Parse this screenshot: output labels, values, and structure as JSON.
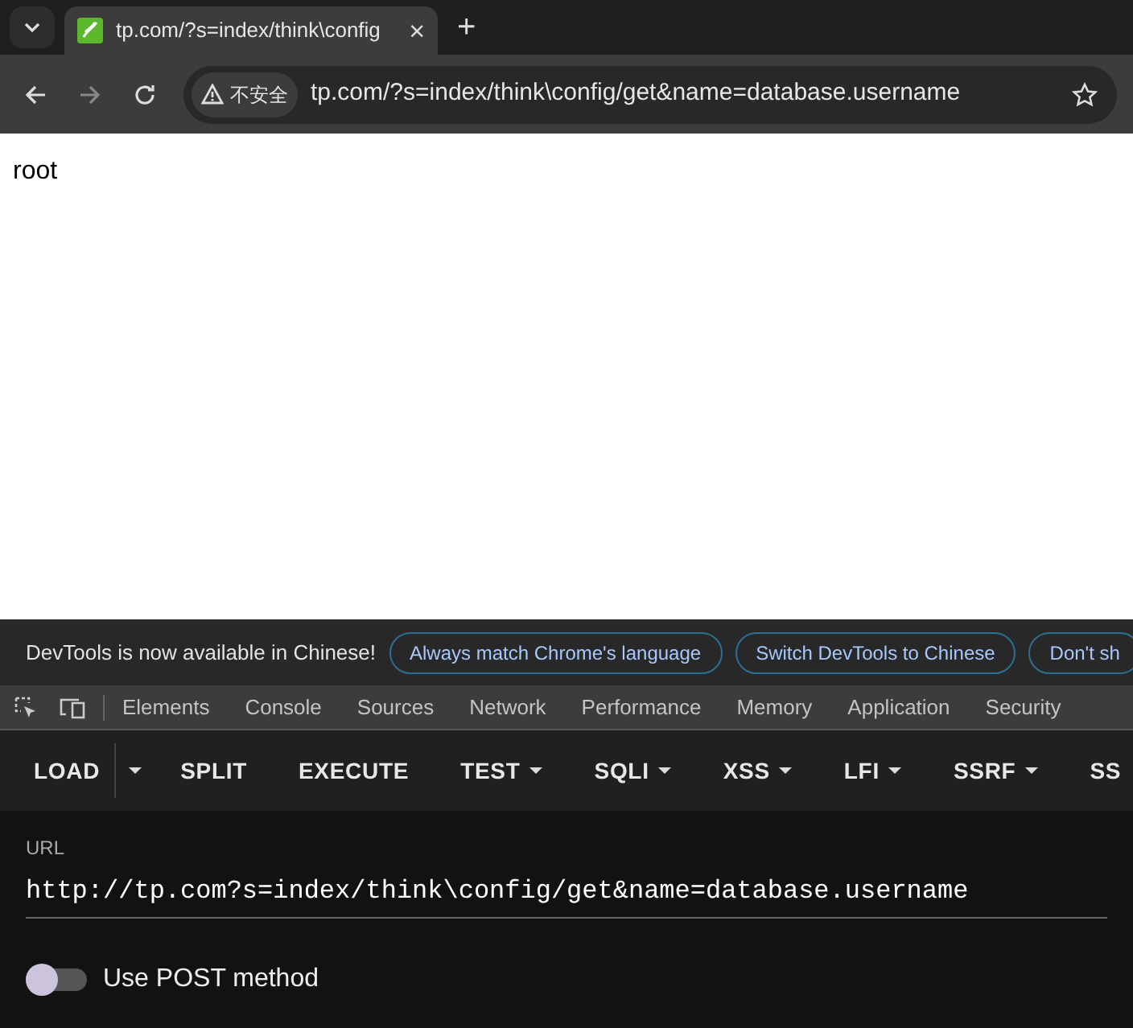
{
  "tab": {
    "title": "tp.com/?s=index/think\\config",
    "close": "×"
  },
  "new_tab": "+",
  "address_bar": {
    "security": "不安全",
    "url": "tp.com/?s=index/think\\config/get&name=database.username"
  },
  "page": {
    "text": "root"
  },
  "infobar": {
    "message": "DevTools is now available in Chinese!",
    "buttons": [
      "Always match Chrome's language",
      "Switch DevTools to Chinese",
      "Don't sh"
    ]
  },
  "devtools_tabs": [
    "Elements",
    "Console",
    "Sources",
    "Network",
    "Performance",
    "Memory",
    "Application",
    "Security"
  ],
  "hackbar": {
    "buttons": [
      {
        "label": "LOAD",
        "kind": "split"
      },
      {
        "label": "SPLIT",
        "kind": "plain"
      },
      {
        "label": "EXECUTE",
        "kind": "plain"
      },
      {
        "label": "TEST",
        "kind": "menu"
      },
      {
        "label": "SQLI",
        "kind": "menu"
      },
      {
        "label": "XSS",
        "kind": "menu"
      },
      {
        "label": "LFI",
        "kind": "menu"
      },
      {
        "label": "SSRF",
        "kind": "menu"
      },
      {
        "label": "SS",
        "kind": "plain"
      }
    ],
    "url_label": "URL",
    "url": "http://tp.com?s=index/think\\config/get&name=database.username",
    "post_toggle": {
      "label": "Use POST method",
      "on": false
    }
  }
}
